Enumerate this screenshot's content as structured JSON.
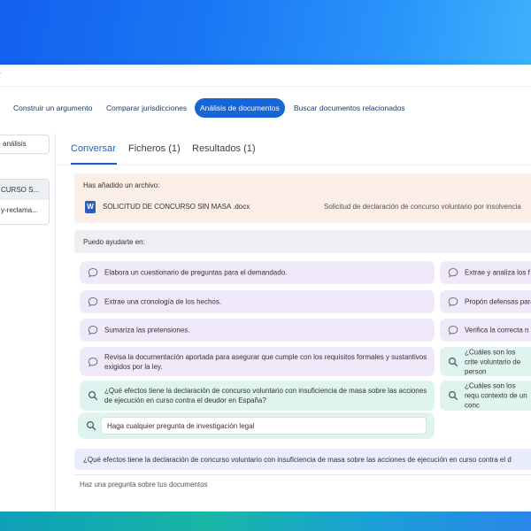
{
  "topbar": {
    "fragment": "r"
  },
  "nav": {
    "items": [
      {
        "label": "Construir un argumento"
      },
      {
        "label": "Comparar jurisdicciones"
      },
      {
        "label": "Análisis de documentos"
      },
      {
        "label": "Buscar documentos relacionados"
      }
    ],
    "active_index": 2
  },
  "sidebar": {
    "analisis_label": "análisis",
    "items": [
      {
        "label": "CURSO S..."
      },
      {
        "label": "y-reclama..."
      }
    ]
  },
  "tabs": [
    {
      "label": "Conversar"
    },
    {
      "label": "Ficheros (1)"
    },
    {
      "label": "Resultados (1)"
    }
  ],
  "file_card": {
    "added_label": "Has añadido un archivo:",
    "icon_letter": "W",
    "file_name": "SOLICITUD DE CONCURSO SIN MASA .docx",
    "file_description": "Solicitud de declaración de concurso voluntario por insolvencia"
  },
  "help": {
    "label": "Puedo ayudarte en:"
  },
  "suggestions_left": [
    {
      "text": "Elabora un cuestionario de preguntas para el demandado.",
      "icon": "chat-bubble-icon"
    },
    {
      "text": "Extrae una cronología de los hechos.",
      "icon": "chat-bubble-icon"
    },
    {
      "text": "Sumariza las pretensiones.",
      "icon": "chat-bubble-icon"
    },
    {
      "text": "Revisa la documentación aportada para asegurar que cumple con los requisitos formales y sustantivos exigidos por la ley.",
      "icon": "chat-bubble-icon"
    },
    {
      "text": "¿Qué efectos tiene la declaración de concurso voluntario con insuficiencia de masa sobre las acciones de ejecución en curso contra el deudor en España?",
      "icon": "search-icon"
    }
  ],
  "suggestions_right": [
    {
      "text": "Extrae y analiza los f",
      "icon": "chat-bubble-icon"
    },
    {
      "text": "Propón defensas para",
      "icon": "chat-bubble-icon"
    },
    {
      "text": "Verifica la correcta n",
      "icon": "chat-bubble-icon"
    },
    {
      "text": "¿Cuáles son los crite voluntario de person",
      "icon": "search-icon"
    },
    {
      "text": "¿Cuáles son los requ contexto de un conc",
      "icon": "search-icon"
    }
  ],
  "search": {
    "value": "Haga cualquier pregunta de investigación legal"
  },
  "query": {
    "text": "¿Qué efectos tiene la declaración de concurso voluntario con insuficiencia de masa sobre las acciones de ejecución en curso contra el d"
  },
  "compose": {
    "placeholder": "Haz una pregunta sobre tus documentos"
  },
  "colors": {
    "accent": "#1666d8",
    "tab_active": "#1f5fbf",
    "suggestion_purple": "#efe9f9",
    "suggestion_teal": "#dff3ef",
    "file_card_bg": "#fbeee6"
  }
}
